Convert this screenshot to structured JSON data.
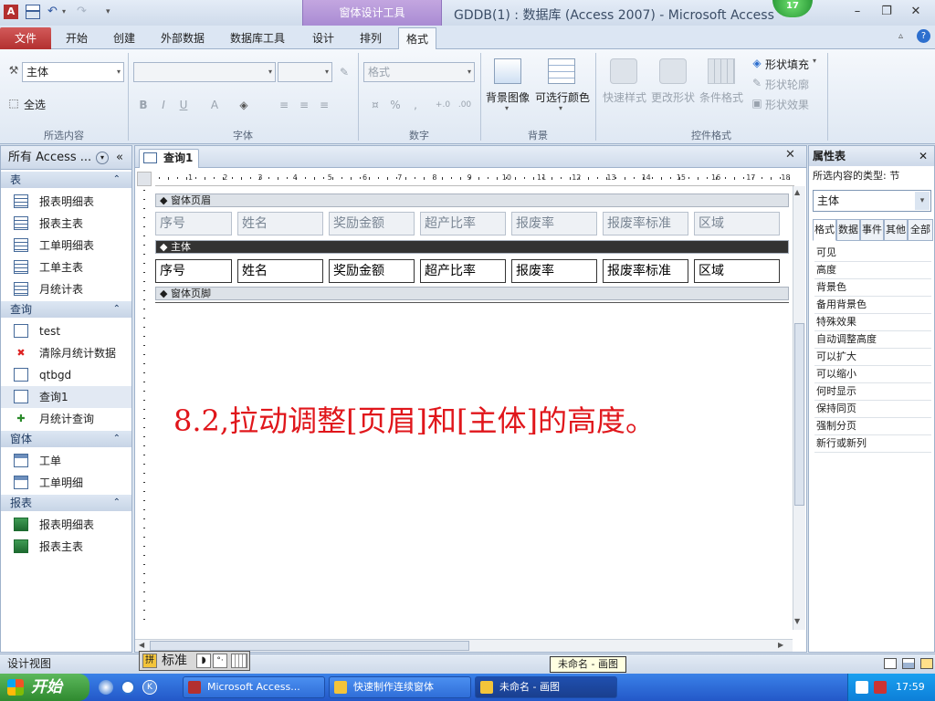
{
  "window": {
    "title": "GDDB(1) : 数据库 (Access 2007)  -  Microsoft Access",
    "context_tab_group": "窗体设计工具",
    "badge": "17"
  },
  "ribbon_tabs": [
    "文件",
    "开始",
    "创建",
    "外部数据",
    "数据库工具",
    "设计",
    "排列",
    "格式"
  ],
  "selected_tab": "格式",
  "ribbon": {
    "selection_combo": "主体",
    "select_all": "全选",
    "groups": [
      "所选内容",
      "字体",
      "数字",
      "背景",
      "控件格式"
    ],
    "number_format_placeholder": "格式",
    "background_image": "背景图像",
    "alt_row_color": "可选行颜色",
    "quick_styles": "快速样式",
    "change_shape": "更改形状",
    "conditional_format": "条件格式",
    "shape_fill": "形状填充",
    "shape_outline": "形状轮廓",
    "shape_effects": "形状效果",
    "font_buttons": [
      "B",
      "I",
      "U",
      "A"
    ],
    "number_buttons": [
      "%",
      ","
    ]
  },
  "nav": {
    "header": "所有 Access ...",
    "sections": [
      {
        "title": "表",
        "items": [
          {
            "label": "报表明细表",
            "icon": "table-icon"
          },
          {
            "label": "报表主表",
            "icon": "table-icon"
          },
          {
            "label": "工单明细表",
            "icon": "table-icon"
          },
          {
            "label": "工单主表",
            "icon": "table-icon"
          },
          {
            "label": "月统计表",
            "icon": "table-icon"
          }
        ]
      },
      {
        "title": "查询",
        "items": [
          {
            "label": "test",
            "icon": "query-icon"
          },
          {
            "label": "清除月统计数据",
            "icon": "delete-query-icon"
          },
          {
            "label": "qtbgd",
            "icon": "query-icon"
          },
          {
            "label": "查询1",
            "icon": "query-icon",
            "selected": true
          },
          {
            "label": "月统计查询",
            "icon": "append-query-icon"
          }
        ]
      },
      {
        "title": "窗体",
        "items": [
          {
            "label": "工单",
            "icon": "form-icon"
          },
          {
            "label": "工单明细",
            "icon": "form-icon"
          }
        ]
      },
      {
        "title": "报表",
        "items": [
          {
            "label": "报表明细表",
            "icon": "report-icon"
          },
          {
            "label": "报表主表",
            "icon": "report-icon"
          }
        ]
      }
    ]
  },
  "document": {
    "tab_label": "查询1",
    "form_header": "窗体页眉",
    "detail": "主体",
    "form_footer": "窗体页脚",
    "header_labels": [
      "序号",
      "姓名",
      "奖励金额",
      "超产比率",
      "报废率",
      "报废率标准",
      "区域"
    ],
    "fields": [
      "序号",
      "姓名",
      "奖励金额",
      "超产比率",
      "报废率",
      "报废率标准",
      "区域"
    ],
    "ruler_numbers": [
      "1",
      "2",
      "3",
      "4",
      "5",
      "6",
      "7",
      "8",
      "9",
      "10",
      "11",
      "12",
      "13",
      "14",
      "15",
      "16",
      "17",
      "18"
    ],
    "annotation": "8.2,拉动调整[页眉]和[主体]的高度。"
  },
  "properties": {
    "title": "属性表",
    "selection_type": "所选内容的类型: 节",
    "selected_object": "主体",
    "tabs": [
      "格式",
      "数据",
      "事件",
      "其他",
      "全部"
    ],
    "selected_tab": "格式",
    "rows": [
      "可见",
      "高度",
      "背景色",
      "备用背景色",
      "特殊效果",
      "自动调整高度",
      "可以扩大",
      "可以缩小",
      "何时显示",
      "保持同页",
      "强制分页",
      "新行或新列"
    ]
  },
  "statusbar": {
    "view": "设计视图",
    "ime_mode": "标准",
    "tooltip": "未命名 - 画图"
  },
  "taskbar": {
    "start": "开始",
    "buttons": [
      "Microsoft Access...",
      "快速制作连续窗体",
      "未命名 - 画图"
    ],
    "clock": "17:59"
  }
}
